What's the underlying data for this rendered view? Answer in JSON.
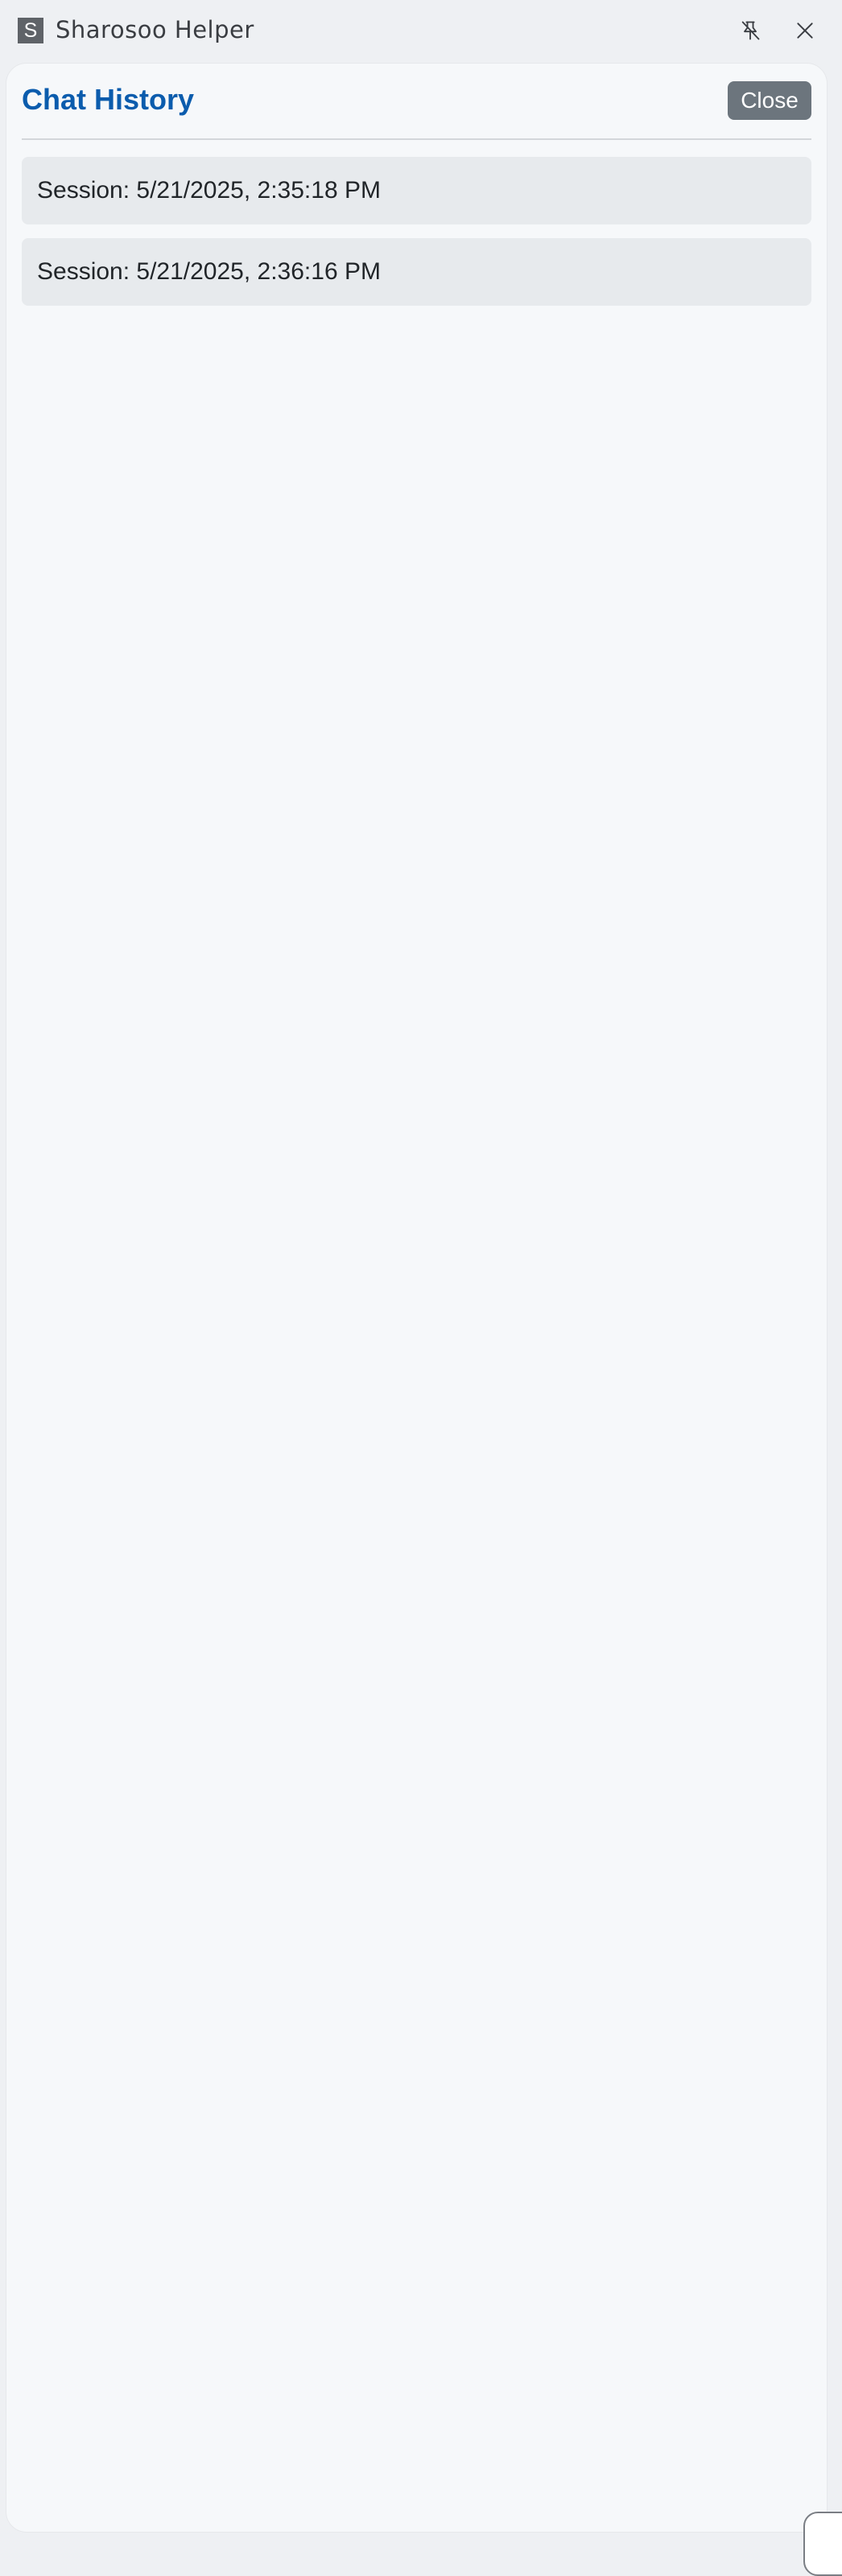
{
  "window": {
    "logo_letter": "S",
    "title": "Sharosoo Helper",
    "pin_icon": "pin-off-icon",
    "close_icon": "close-icon"
  },
  "panel": {
    "title": "Chat History",
    "close_label": "Close",
    "sessions": [
      {
        "label": "Session: 5/21/2025, 2:35:18 PM"
      },
      {
        "label": "Session: 5/21/2025, 2:36:16 PM"
      }
    ]
  },
  "colors": {
    "accent": "#0b5cad",
    "close_button": "#6c757d",
    "session_bg": "#e7eaed",
    "panel_bg": "#f6f8fa",
    "window_bg": "#eef0f3"
  }
}
